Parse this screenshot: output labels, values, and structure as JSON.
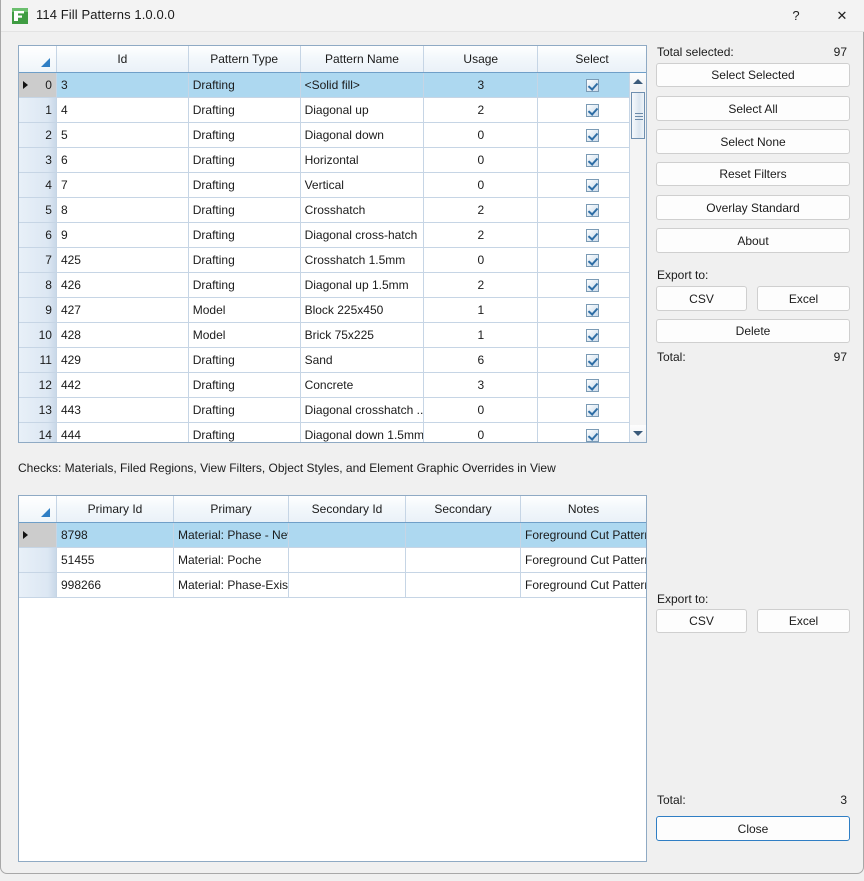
{
  "window": {
    "title": "114 Fill Patterns 1.0.0.0",
    "app_icon": "fill-pattern-app-icon",
    "help_label": "?",
    "close_label": "✕"
  },
  "main_grid": {
    "columns": [
      "Id",
      "Pattern Type",
      "Pattern Name",
      "Usage",
      "Select"
    ],
    "rows": [
      {
        "n": "0",
        "id": "3",
        "type": "Drafting",
        "name": "<Solid fill>",
        "usage": "3",
        "select": true,
        "selected": true
      },
      {
        "n": "1",
        "id": "4",
        "type": "Drafting",
        "name": "Diagonal up",
        "usage": "2",
        "select": true,
        "selected": false
      },
      {
        "n": "2",
        "id": "5",
        "type": "Drafting",
        "name": "Diagonal down",
        "usage": "0",
        "select": true,
        "selected": false
      },
      {
        "n": "3",
        "id": "6",
        "type": "Drafting",
        "name": "Horizontal",
        "usage": "0",
        "select": true,
        "selected": false
      },
      {
        "n": "4",
        "id": "7",
        "type": "Drafting",
        "name": "Vertical",
        "usage": "0",
        "select": true,
        "selected": false
      },
      {
        "n": "5",
        "id": "8",
        "type": "Drafting",
        "name": "Crosshatch",
        "usage": "2",
        "select": true,
        "selected": false
      },
      {
        "n": "6",
        "id": "9",
        "type": "Drafting",
        "name": "Diagonal cross-hatch",
        "usage": "2",
        "select": true,
        "selected": false
      },
      {
        "n": "7",
        "id": "425",
        "type": "Drafting",
        "name": "Crosshatch 1.5mm",
        "usage": "0",
        "select": true,
        "selected": false
      },
      {
        "n": "8",
        "id": "426",
        "type": "Drafting",
        "name": "Diagonal up 1.5mm",
        "usage": "2",
        "select": true,
        "selected": false
      },
      {
        "n": "9",
        "id": "427",
        "type": "Model",
        "name": "Block 225x450",
        "usage": "1",
        "select": true,
        "selected": false
      },
      {
        "n": "10",
        "id": "428",
        "type": "Model",
        "name": "Brick 75x225",
        "usage": "1",
        "select": true,
        "selected": false
      },
      {
        "n": "11",
        "id": "429",
        "type": "Drafting",
        "name": "Sand",
        "usage": "6",
        "select": true,
        "selected": false
      },
      {
        "n": "12",
        "id": "442",
        "type": "Drafting",
        "name": "Concrete",
        "usage": "3",
        "select": true,
        "selected": false
      },
      {
        "n": "13",
        "id": "443",
        "type": "Drafting",
        "name": "Diagonal crosshatch ...",
        "usage": "0",
        "select": true,
        "selected": false
      },
      {
        "n": "14",
        "id": "444",
        "type": "Drafting",
        "name": "Diagonal down 1.5mm",
        "usage": "0",
        "select": true,
        "selected": false
      }
    ]
  },
  "note": "Checks: Materials, Filed Regions, View Filters, Object Styles, and Element Graphic Overrides in View",
  "detail_grid": {
    "columns": [
      "Primary Id",
      "Primary",
      "Secondary Id",
      "Secondary",
      "Notes"
    ],
    "rows": [
      {
        "primary_id": "8798",
        "primary": "Material: Phase - New",
        "secondary_id": "",
        "secondary": "",
        "notes": "Foreground Cut Pattern",
        "selected": true
      },
      {
        "primary_id": "51455",
        "primary": "Material: Poche",
        "secondary_id": "",
        "secondary": "",
        "notes": "Foreground Cut Pattern",
        "selected": false
      },
      {
        "primary_id": "998266",
        "primary": "Material: Phase-Exist",
        "secondary_id": "",
        "secondary": "",
        "notes": "Foreground Cut Pattern",
        "selected": false
      }
    ]
  },
  "right_panel": {
    "total_selected_label": "Total selected:",
    "total_selected_value": "97",
    "select_selected": "Select Selected",
    "select_all": "Select All",
    "select_none": "Select None",
    "reset_filters": "Reset Filters",
    "overlay_standard": "Overlay Standard",
    "about": "About",
    "export_to_label": "Export to:",
    "csv": "CSV",
    "excel": "Excel",
    "delete": "Delete",
    "total_label": "Total:",
    "total_value": "97"
  },
  "bottom_panel": {
    "export_to_label": "Export to:",
    "csv": "CSV",
    "excel": "Excel",
    "total_label": "Total:",
    "total_value": "3",
    "close": "Close"
  }
}
